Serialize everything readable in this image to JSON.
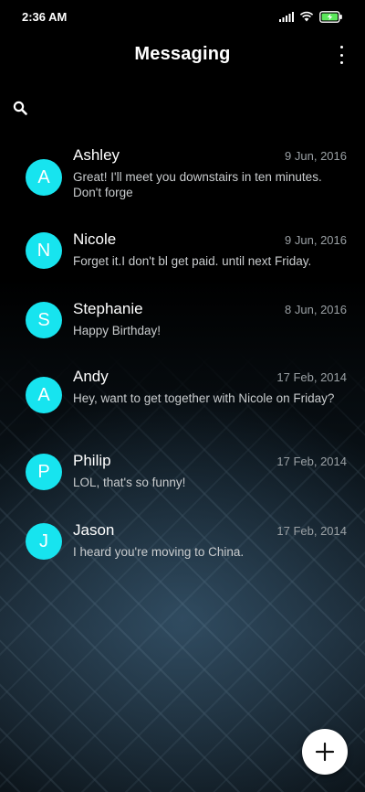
{
  "status_bar": {
    "time": "2:36 AM"
  },
  "header": {
    "title": "Messaging"
  },
  "conversations": [
    {
      "initial": "A",
      "name": "Ashley",
      "date": "9 Jun, 2016",
      "snippet": "Great! I'll meet you downstairs in ten minutes. Don't forge"
    },
    {
      "initial": "N",
      "name": "Nicole",
      "date": "9 Jun, 2016",
      "snippet": "Forget it.I don't bl get paid. until next Friday."
    },
    {
      "initial": "S",
      "name": "Stephanie",
      "date": "8 Jun, 2016",
      "snippet": "Happy Birthday!"
    },
    {
      "initial": "A",
      "name": "Andy",
      "date": "17 Feb, 2014",
      "snippet": "Hey, want to get together with Nicole on Friday?"
    },
    {
      "initial": "P",
      "name": "Philip",
      "date": "17 Feb, 2014",
      "snippet": "LOL, that's so funny!"
    },
    {
      "initial": "J",
      "name": "Jason",
      "date": "17 Feb, 2014",
      "snippet": "I heard you're moving to China."
    }
  ],
  "colors": {
    "avatar": "#17e4ef",
    "background": "#000000",
    "fab": "#ffffff"
  },
  "icons": [
    "signal-icon",
    "wifi-icon",
    "battery-icon",
    "more-options-icon",
    "search-icon",
    "add-icon"
  ]
}
